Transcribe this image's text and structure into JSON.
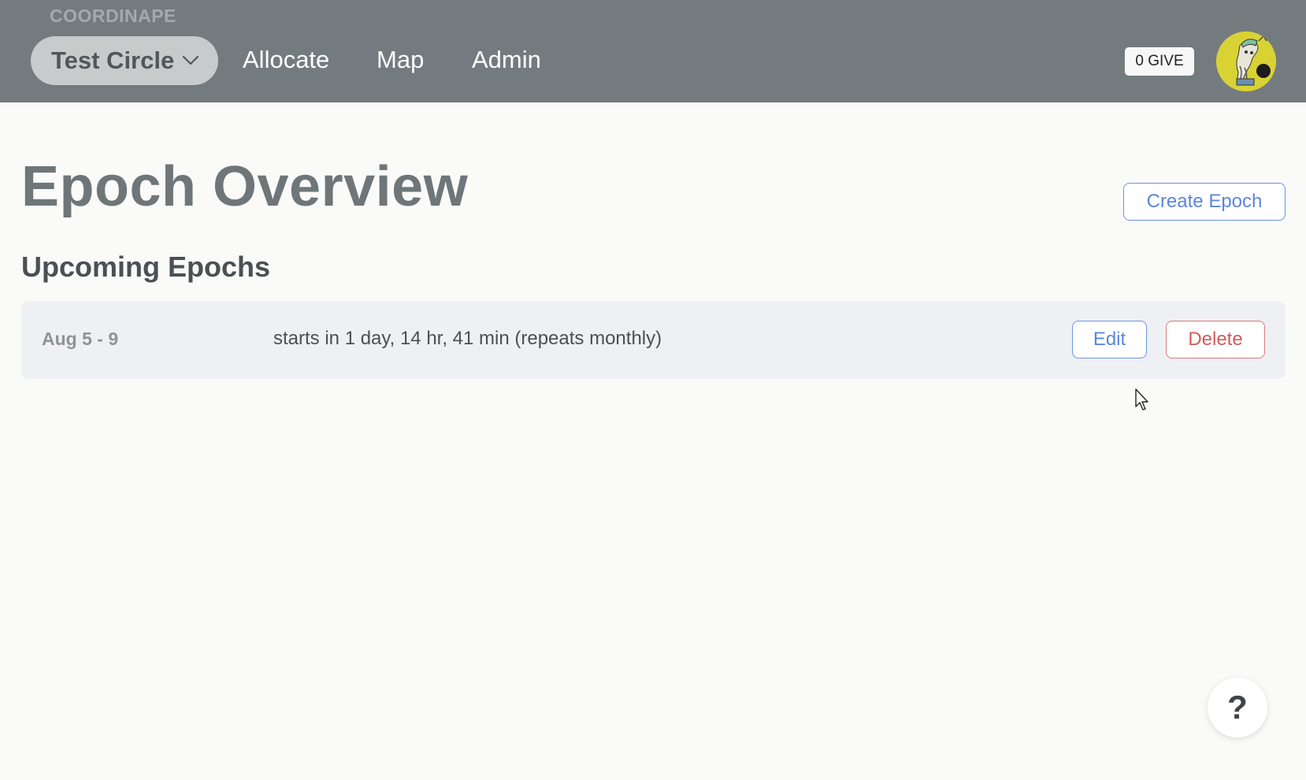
{
  "header": {
    "brand": "COORDINAPE",
    "circle_name": "Test Circle",
    "nav": [
      "Allocate",
      "Map",
      "Admin"
    ],
    "give_balance": "0 GIVE"
  },
  "main": {
    "title": "Epoch Overview",
    "create_label": "Create Epoch",
    "upcoming_title": "Upcoming Epochs",
    "epochs": [
      {
        "dates": "Aug 5 - 9",
        "description": "starts in 1 day, 14 hr, 41 min (repeats monthly)",
        "edit_label": "Edit",
        "delete_label": "Delete"
      }
    ]
  },
  "help": {
    "label": "?"
  },
  "colors": {
    "header_bg": "#747b7f",
    "accent_blue": "#5b86dd",
    "danger_red": "#d05b5b",
    "avatar_bg": "#d9d234"
  }
}
